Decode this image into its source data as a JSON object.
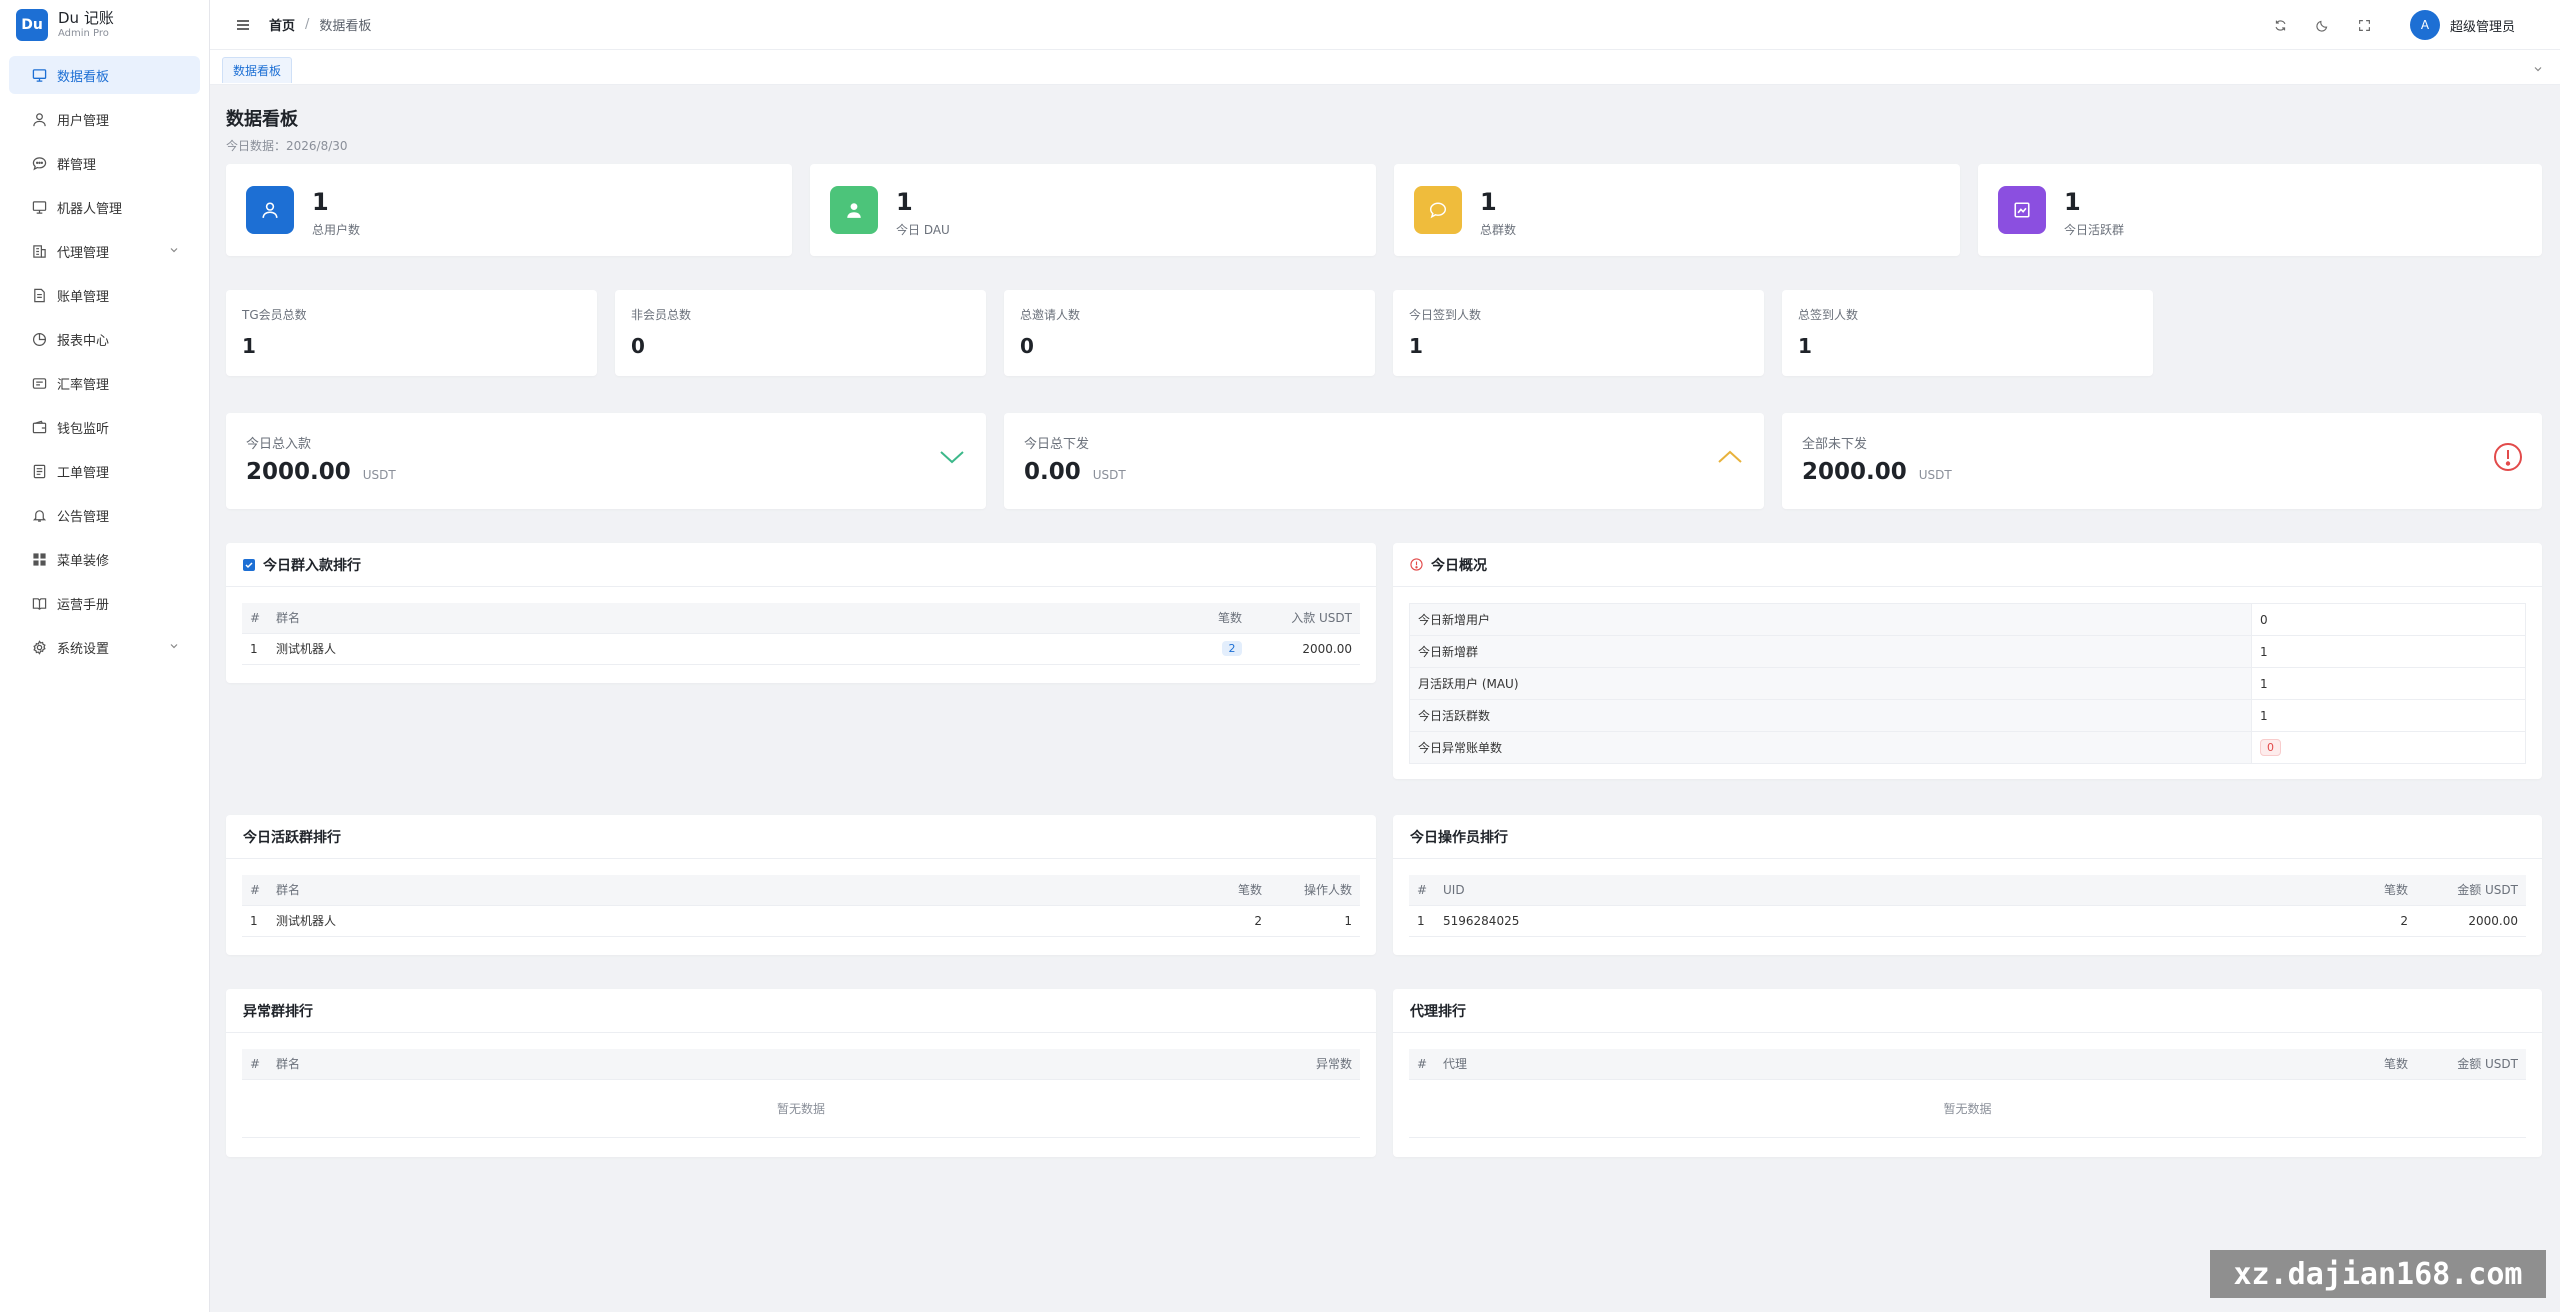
{
  "brand": {
    "logo": "Du",
    "title": "Du 记账",
    "subtitle": "Admin Pro"
  },
  "sidebar": {
    "items": [
      {
        "label": "数据看板",
        "icon": "dashboard-icon",
        "active": true
      },
      {
        "label": "用户管理",
        "icon": "user-icon"
      },
      {
        "label": "群管理",
        "icon": "chat-icon"
      },
      {
        "label": "机器人管理",
        "icon": "monitor-icon"
      },
      {
        "label": "代理管理",
        "icon": "building-icon",
        "expandable": true
      },
      {
        "label": "账单管理",
        "icon": "document-icon"
      },
      {
        "label": "报表中心",
        "icon": "pie-chart-icon"
      },
      {
        "label": "汇率管理",
        "icon": "exchange-icon"
      },
      {
        "label": "钱包监听",
        "icon": "wallet-icon"
      },
      {
        "label": "工单管理",
        "icon": "ticket-icon"
      },
      {
        "label": "公告管理",
        "icon": "bell-icon"
      },
      {
        "label": "菜单装修",
        "icon": "grid-icon"
      },
      {
        "label": "运营手册",
        "icon": "book-icon"
      },
      {
        "label": "系统设置",
        "icon": "gear-icon",
        "expandable": true
      }
    ]
  },
  "header": {
    "breadcrumb_home": "首页",
    "breadcrumb_sep": "/",
    "breadcrumb_current": "数据看板",
    "user_avatar": "A",
    "user_name": "超级管理员"
  },
  "tabs": {
    "active": "数据看板"
  },
  "page": {
    "title": "数据看板",
    "subtitle": "今日数据：2026/8/30"
  },
  "stats": [
    {
      "value": "1",
      "label": "总用户数",
      "color": "#1d6fd4",
      "icon": "user-icon"
    },
    {
      "value": "1",
      "label": "今日 DAU",
      "color": "#4cc47a",
      "icon": "person-icon"
    },
    {
      "value": "1",
      "label": "总群数",
      "color": "#efbc3c",
      "icon": "chat-icon"
    },
    {
      "value": "1",
      "label": "今日活跃群",
      "color": "#8b4fe0",
      "icon": "trend-icon"
    }
  ],
  "mini_stats": [
    {
      "label": "TG会员总数",
      "value": "1"
    },
    {
      "label": "非会员总数",
      "value": "0"
    },
    {
      "label": "总邀请人数",
      "value": "0"
    },
    {
      "label": "今日签到人数",
      "value": "1"
    },
    {
      "label": "总签到人数",
      "value": "1"
    }
  ],
  "amounts": [
    {
      "label": "今日总入款",
      "value": "2000.00",
      "unit": "USDT",
      "icon": "chevron-down-icon",
      "color": "#3cb88a"
    },
    {
      "label": "今日总下发",
      "value": "0.00",
      "unit": "USDT",
      "icon": "chevron-up-icon",
      "color": "#e8b23c"
    },
    {
      "label": "全部未下发",
      "value": "2000.00",
      "unit": "USDT",
      "icon": "alert-circle-icon",
      "color": "#e24a4a"
    }
  ],
  "income_rank": {
    "title": "今日群入款排行",
    "headers": [
      "#",
      "群名",
      "笔数",
      "入款 USDT"
    ],
    "rows": [
      {
        "idx": "1",
        "name": "测试机器人",
        "count": "2",
        "amount": "2000.00"
      }
    ]
  },
  "overview": {
    "title": "今日概况",
    "rows": [
      {
        "k": "今日新增用户",
        "v": "0"
      },
      {
        "k": "今日新增群",
        "v": "1"
      },
      {
        "k": "月活跃用户 (MAU)",
        "v": "1"
      },
      {
        "k": "今日活跃群数",
        "v": "1"
      },
      {
        "k": "今日异常账单数",
        "v": "0"
      }
    ]
  },
  "active_rank": {
    "title": "今日活跃群排行",
    "headers": [
      "#",
      "群名",
      "笔数",
      "操作人数"
    ],
    "rows": [
      {
        "idx": "1",
        "name": "测试机器人",
        "count": "2",
        "ops": "1"
      }
    ]
  },
  "operator_rank": {
    "title": "今日操作员排行",
    "headers": [
      "#",
      "UID",
      "笔数",
      "金额 USDT"
    ],
    "rows": [
      {
        "idx": "1",
        "uid": "5196284025",
        "count": "2",
        "amount": "2000.00"
      }
    ]
  },
  "abnormal_rank": {
    "title": "异常群排行",
    "headers": [
      "#",
      "群名",
      "异常数"
    ],
    "empty": "暂无数据"
  },
  "agent_rank": {
    "title": "代理排行",
    "headers": [
      "#",
      "代理",
      "笔数",
      "金额 USDT"
    ],
    "empty": "暂无数据"
  },
  "watermark": "xz.dajian168.com"
}
